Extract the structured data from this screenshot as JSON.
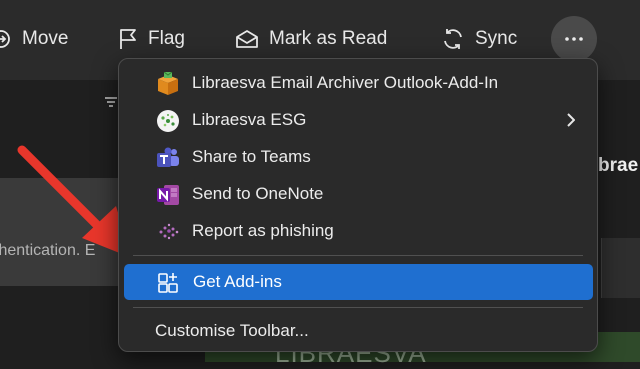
{
  "toolbar": {
    "move": "Move",
    "flag": "Flag",
    "mark_as_read": "Mark as Read",
    "sync": "Sync",
    "more_icon": "ellipsis-icon"
  },
  "background": {
    "left_text": "thentication. E",
    "right_text": "brae",
    "green_text": "LIBRAESVA"
  },
  "menu": {
    "items": [
      {
        "label": "Libraesva Email Archiver Outlook-Add-In",
        "icon": "archive-box-icon"
      },
      {
        "label": "Libraesva ESG",
        "icon": "libraesva-logo-icon",
        "has_submenu": true
      },
      {
        "label": "Share to Teams",
        "icon": "teams-icon"
      },
      {
        "label": "Send to OneNote",
        "icon": "onenote-icon"
      },
      {
        "label": "Report as phishing",
        "icon": "phishing-icon"
      }
    ],
    "get_addins": {
      "label": "Get Add-ins",
      "icon": "add-grid-icon"
    },
    "customise": {
      "label": "Customise Toolbar..."
    }
  },
  "colors": {
    "accent": "#1f6fd0",
    "arrow": "#e8362b",
    "menu_bg": "#2a2a2a"
  }
}
